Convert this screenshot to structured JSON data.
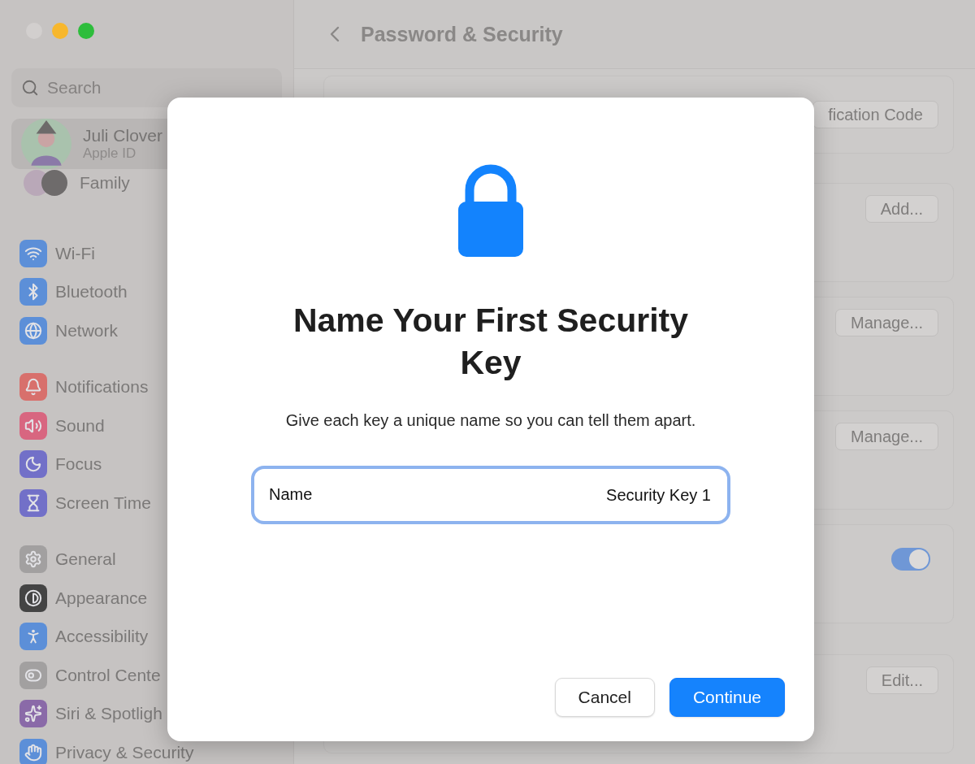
{
  "window": {
    "controls": [
      {
        "color": "#d2cfce"
      },
      {
        "color": "#f7b72d"
      },
      {
        "color": "#2ebd3c"
      }
    ]
  },
  "sidebar": {
    "search": {
      "placeholder": "Search"
    },
    "account": {
      "name": "Juli Clover",
      "subtitle": "Apple ID",
      "selected": true
    },
    "family": {
      "label": "Family"
    },
    "groups": [
      [
        {
          "label": "Wi-Fi",
          "kind": "wifi",
          "color": "#5c8fd8"
        },
        {
          "label": "Bluetooth",
          "kind": "bluetooth",
          "color": "#5c8fd8"
        },
        {
          "label": "Network",
          "kind": "globe",
          "color": "#5c8fd8"
        }
      ],
      [
        {
          "label": "Notifications",
          "kind": "bell",
          "color": "#d8706c"
        },
        {
          "label": "Sound",
          "kind": "speaker",
          "color": "#d86680"
        },
        {
          "label": "Focus",
          "kind": "moon",
          "color": "#7270c8"
        },
        {
          "label": "Screen Time",
          "kind": "hourglass",
          "color": "#7270c8"
        }
      ],
      [
        {
          "label": "General",
          "kind": "gear",
          "color": "#a2a0a0"
        },
        {
          "label": "Appearance",
          "kind": "contrast",
          "color": "#444444"
        },
        {
          "label": "Accessibility",
          "kind": "person",
          "color": "#5c8fd8"
        },
        {
          "label": "Control Cente",
          "kind": "toggles",
          "color": "#a2a0a0"
        },
        {
          "label": "Siri & Spotligh",
          "kind": "orb",
          "color": "#8a6aa8"
        },
        {
          "label": "Privacy & Security",
          "kind": "hand",
          "color": "#5c8fd8"
        }
      ]
    ]
  },
  "header": {
    "title": "Password & Security"
  },
  "cards": [
    {
      "kind": "button",
      "label": "fication Code"
    },
    {
      "kind": "button",
      "label": "Add..."
    },
    {
      "kind": "button",
      "label": "Manage..."
    },
    {
      "kind": "button",
      "label": "Manage..."
    },
    {
      "kind": "toggle",
      "on": true
    },
    {
      "kind": "button",
      "label": "Edit..."
    }
  ],
  "dialog": {
    "title": "Name Your First Security Key",
    "message": "Give each key a unique name so you can tell them apart.",
    "field": {
      "label": "Name",
      "value": "Security Key 1",
      "focused": true
    },
    "buttons": [
      {
        "label": "Cancel",
        "primary": false
      },
      {
        "label": "Continue",
        "primary": true
      }
    ]
  }
}
